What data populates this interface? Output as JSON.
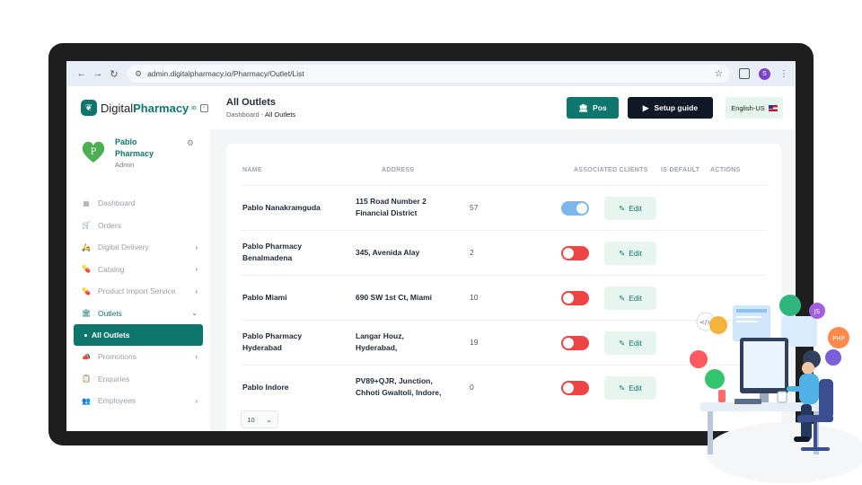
{
  "browser": {
    "url": "admin.digitalpharmacy.io/Pharmacy/Outlet/List",
    "profile_initial": "S"
  },
  "brand": {
    "name_plain": "Digital",
    "name_bold": "Pharmacy",
    "suffix": ".io",
    "color": "#0f766e"
  },
  "page": {
    "title": "All Outlets",
    "breadcrumb_root": "Dashboard",
    "breadcrumb_sep": "-",
    "breadcrumb_current": "All Outlets"
  },
  "header": {
    "pos_label": "Pos",
    "guide_label": "Setup guide",
    "language_label": "English-US"
  },
  "profile": {
    "name": "Pablo Pharmacy",
    "role": "Admin",
    "avatar_letter": "P"
  },
  "sidebar": {
    "items": [
      {
        "label": "Dashboard",
        "icon": "grid-icon",
        "glyph": "▦",
        "chevron": ""
      },
      {
        "label": "Orders",
        "icon": "cart-icon",
        "glyph": "🛒",
        "chevron": ""
      },
      {
        "label": "Digital Delivery",
        "icon": "scooter-icon",
        "glyph": "🛵",
        "chevron": "›"
      },
      {
        "label": "Catalog",
        "icon": "pill-icon",
        "glyph": "💊",
        "chevron": "›"
      },
      {
        "label": "Product Import Service",
        "icon": "pill-import-icon",
        "glyph": "💊",
        "chevron": "›"
      },
      {
        "label": "Outlets",
        "icon": "bank-icon",
        "glyph": "🏛",
        "chevron": "⌄"
      },
      {
        "label": "Promotions",
        "icon": "megaphone-icon",
        "glyph": "📣",
        "chevron": "›"
      },
      {
        "label": "Enquiries",
        "icon": "clipboard-icon",
        "glyph": "📋",
        "chevron": ""
      },
      {
        "label": "Employees",
        "icon": "users-icon",
        "glyph": "👥",
        "chevron": "›"
      }
    ],
    "active_sub": "All Outlets"
  },
  "table": {
    "headers": [
      "NAME",
      "ADDRESS",
      "ASSOCIATED CLIENTS",
      "IS DEFAULT",
      "ACTIONS"
    ],
    "rows": [
      {
        "name": "Pablo Nanakramguda",
        "address": "115 Road Number 2 Financial District",
        "clients": "57",
        "is_default": true
      },
      {
        "name": "Pablo Pharmacy Benalmadena",
        "address": "345, Avenida Alay",
        "clients": "2",
        "is_default": false
      },
      {
        "name": "Pablo Miami",
        "address": "690 SW 1st Ct, Miami",
        "clients": "10",
        "is_default": false
      },
      {
        "name": "Pablo Pharmacy Hyderabad",
        "address": "Langar Houz, Hyderabad,",
        "clients": "19",
        "is_default": false
      },
      {
        "name": "Pablo Indore",
        "address": "PV89+QJR, Junction, Chhoti Gwaltoli, Indore,",
        "clients": "0",
        "is_default": false
      }
    ],
    "edit_label": "Edit",
    "page_size": "10"
  }
}
